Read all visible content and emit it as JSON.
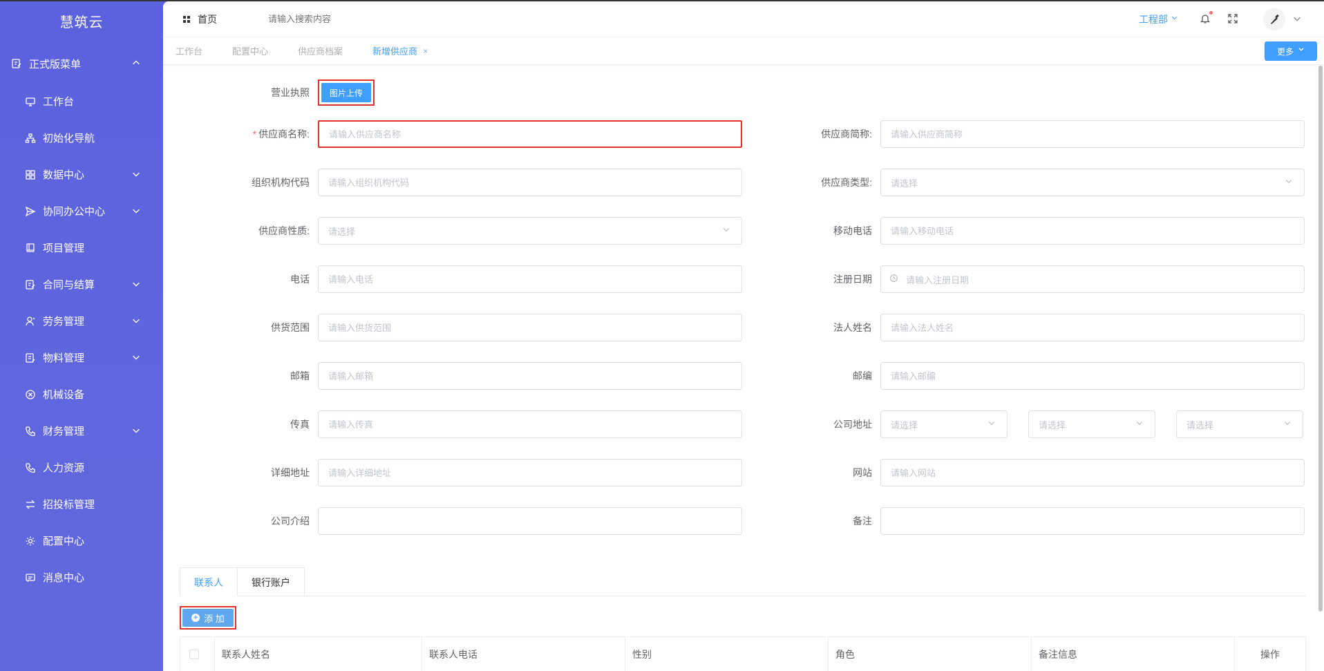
{
  "brand": "慧筑云",
  "sidebar": {
    "group": {
      "label": "正式版菜单",
      "icon": "menu-edit-icon"
    },
    "items": [
      {
        "label": "工作台",
        "icon": "monitor-icon",
        "has_children": false
      },
      {
        "label": "初始化导航",
        "icon": "org-tree-icon",
        "has_children": false
      },
      {
        "label": "数据中心",
        "icon": "grid-icon",
        "has_children": true
      },
      {
        "label": "协同办公中心",
        "icon": "send-icon",
        "has_children": true
      },
      {
        "label": "项目管理",
        "icon": "book-icon",
        "has_children": false
      },
      {
        "label": "合同与结算",
        "icon": "contract-icon",
        "has_children": true
      },
      {
        "label": "劳务管理",
        "icon": "worker-icon",
        "has_children": true
      },
      {
        "label": "物料管理",
        "icon": "material-icon",
        "has_children": true
      },
      {
        "label": "机械设备",
        "icon": "close-circle-icon",
        "has_children": false
      },
      {
        "label": "财务管理",
        "icon": "phone-icon",
        "has_children": true
      },
      {
        "label": "人力资源",
        "icon": "phone-icon",
        "has_children": false
      },
      {
        "label": "招投标管理",
        "icon": "swap-icon",
        "has_children": false
      },
      {
        "label": "配置中心",
        "icon": "gear-icon",
        "has_children": false
      },
      {
        "label": "消息中心",
        "icon": "message-icon",
        "has_children": false
      }
    ]
  },
  "header": {
    "home_label": "首页",
    "search_placeholder": "请输入搜索内容",
    "department": "工程部"
  },
  "tabs": [
    {
      "label": "工作台",
      "active": false
    },
    {
      "label": "配置中心",
      "active": false
    },
    {
      "label": "供应商档案",
      "active": false
    },
    {
      "label": "新增供应商",
      "active": true,
      "close": "×"
    }
  ],
  "more_label": "更多",
  "form": {
    "license_label": "营业执照",
    "upload_label": "图片上传",
    "required_mark": "*",
    "left": [
      {
        "label": "供应商名称:",
        "placeholder": "请输入供应商名称",
        "type": "input"
      },
      {
        "label": "组织机构代码",
        "placeholder": "请输入组织机构代码",
        "type": "input"
      },
      {
        "label": "供应商性质:",
        "placeholder": "请选择",
        "type": "select"
      },
      {
        "label": "电话",
        "placeholder": "请输入电话",
        "type": "input"
      },
      {
        "label": "供货范围",
        "placeholder": "请输入供货范围",
        "type": "input"
      },
      {
        "label": "邮箱",
        "placeholder": "请输入邮箱",
        "type": "input"
      },
      {
        "label": "传真",
        "placeholder": "请输入传真",
        "type": "input"
      },
      {
        "label": "详细地址",
        "placeholder": "请输入详细地址",
        "type": "input"
      },
      {
        "label": "公司介绍",
        "placeholder": "",
        "type": "input"
      }
    ],
    "right": [
      {
        "label": "供应商简称:",
        "placeholder": "请输入供应商简称",
        "type": "input"
      },
      {
        "label": "供应商类型:",
        "placeholder": "请选择",
        "type": "select"
      },
      {
        "label": "移动电话",
        "placeholder": "请输入移动电话",
        "type": "input"
      },
      {
        "label": "注册日期",
        "placeholder": "请输入注册日期",
        "type": "date"
      },
      {
        "label": "法人姓名",
        "placeholder": "请输入法人姓名",
        "type": "input"
      },
      {
        "label": "邮编",
        "placeholder": "请输入邮编",
        "type": "input"
      },
      {
        "label": "公司地址",
        "placeholder": "请选择",
        "type": "address"
      },
      {
        "label": "网站",
        "placeholder": "请输入网站",
        "type": "input"
      },
      {
        "label": "备注",
        "placeholder": "",
        "type": "input"
      }
    ]
  },
  "subtabs": [
    {
      "label": "联系人",
      "active": true
    },
    {
      "label": "银行账户",
      "active": false
    }
  ],
  "add_label": "添 加",
  "table": {
    "columns": [
      "联系人姓名",
      "联系人电话",
      "性别",
      "角色",
      "备注信息",
      "操作"
    ]
  },
  "colors": {
    "primary": "#409eff",
    "sidebar": "#5f64d9",
    "highlight": "#e0302c"
  }
}
